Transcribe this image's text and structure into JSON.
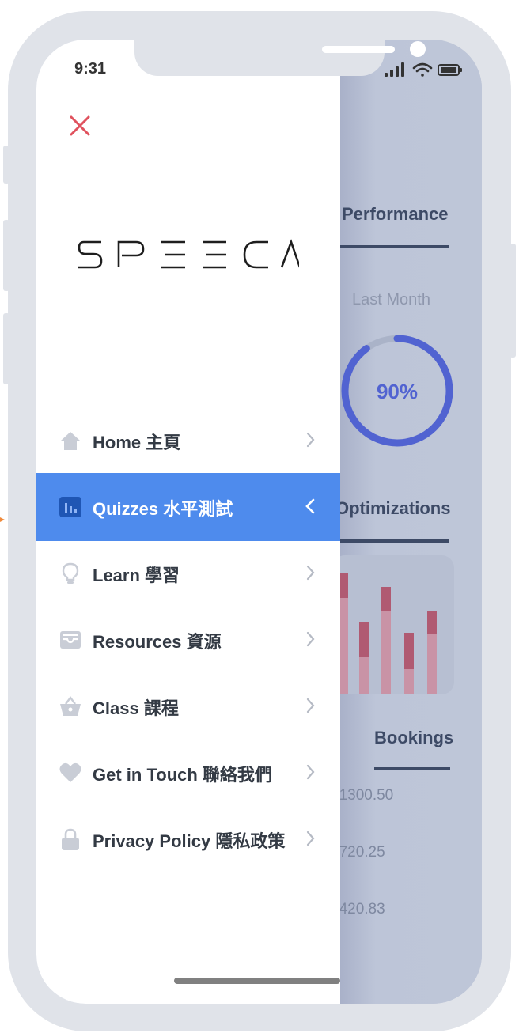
{
  "status_bar": {
    "time": "9:31"
  },
  "drawer": {
    "logo_text": "SPEECA",
    "items": [
      {
        "label": "Home 主頁",
        "icon": "home-icon",
        "active": false
      },
      {
        "label": "Quizzes 水平測試",
        "icon": "bar-chart-icon",
        "active": true
      },
      {
        "label": "Learn 學習",
        "icon": "lightbulb-icon",
        "active": false
      },
      {
        "label": "Resources 資源",
        "icon": "tray-icon",
        "active": false
      },
      {
        "label": "Class 課程",
        "icon": "basket-icon",
        "active": false
      },
      {
        "label": "Get in Touch 聯絡我們",
        "icon": "heart-icon",
        "active": false
      },
      {
        "label": "Privacy Policy 隱私政策",
        "icon": "lock-icon",
        "active": false
      }
    ]
  },
  "background": {
    "performance_title": "Performance",
    "last_month_label": "Last Month",
    "percent": "90%",
    "percent_value": 90,
    "optimizations_title": "Optimizations",
    "bookings_title": "Bookings",
    "bookings": [
      "$1300.50",
      "$720.25",
      "$420.83"
    ]
  },
  "colors": {
    "accent": "#4e8bed",
    "close": "#e0525e",
    "donut": "#5163d1",
    "bar_dark": "#b05a72",
    "bar_light": "#c993a6"
  }
}
